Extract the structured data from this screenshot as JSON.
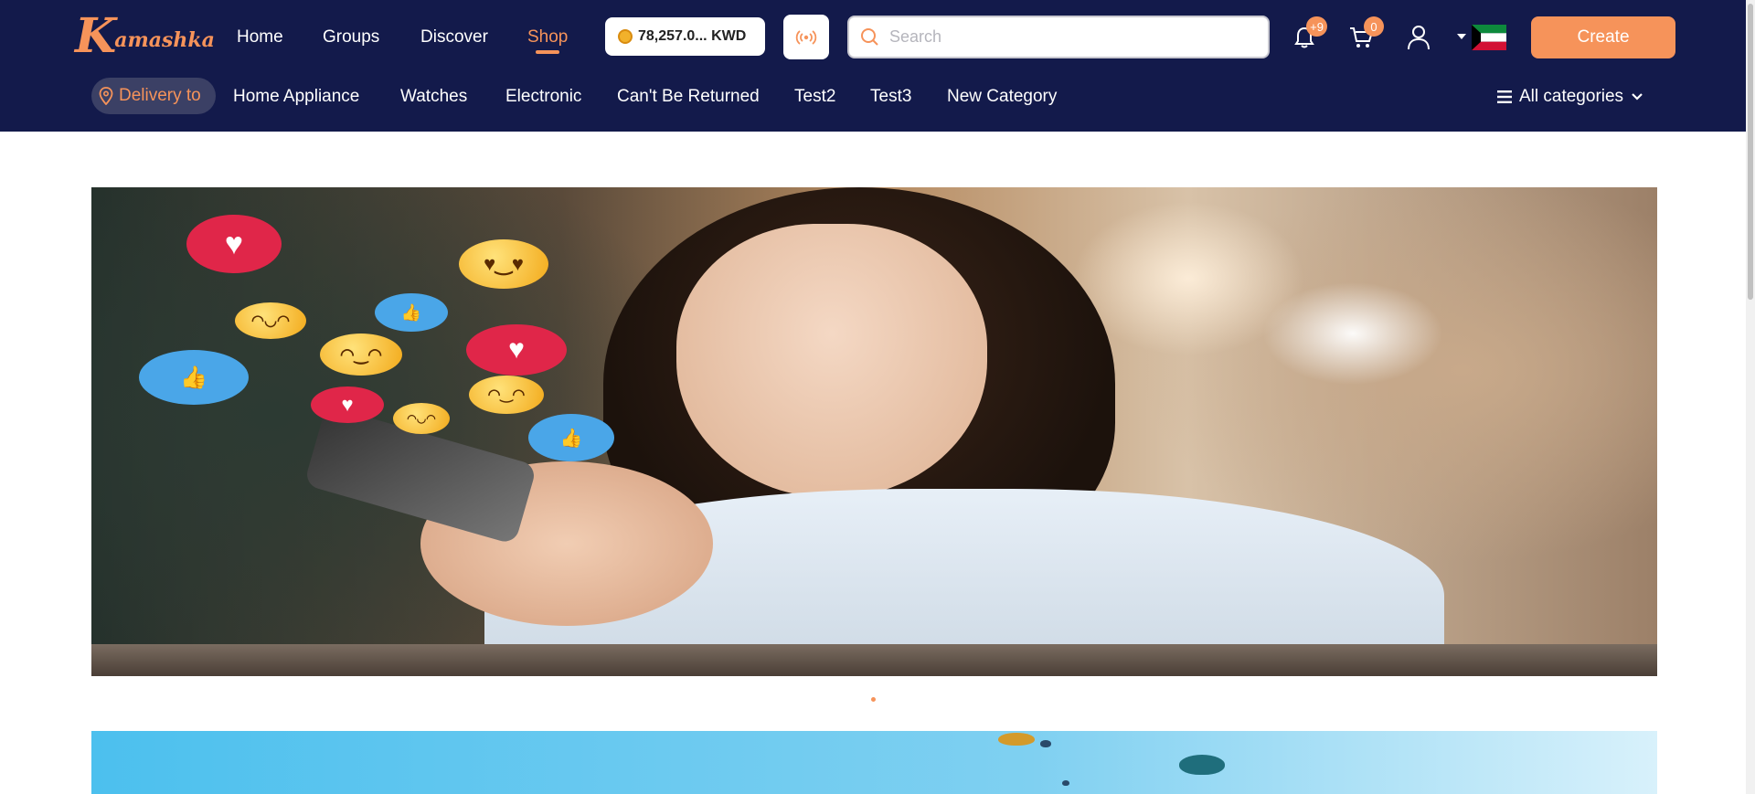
{
  "brand": {
    "logo_initial": "K",
    "logo_rest": "amashka"
  },
  "nav": {
    "items": [
      {
        "label": "Home",
        "active": false
      },
      {
        "label": "Groups",
        "active": false
      },
      {
        "label": "Discover",
        "active": false
      },
      {
        "label": "Shop",
        "active": true
      }
    ]
  },
  "wallet": {
    "balance": "78,257.0... KWD",
    "icon": "coin-icon"
  },
  "live": {
    "icon": "broadcast-icon"
  },
  "search": {
    "placeholder": "Search",
    "value": ""
  },
  "notifications": {
    "count": "+9",
    "icon": "bell-icon"
  },
  "cart": {
    "count": "0",
    "icon": "cart-icon"
  },
  "user": {
    "icon": "user-icon"
  },
  "country": {
    "icon": "kuwait-flag-icon"
  },
  "create_label": "Create",
  "subnav": {
    "delivery_label": "Delivery to",
    "categories": [
      "Home Appliance",
      "Watches",
      "Electronic",
      "Can't Be Returned",
      "Test2",
      "Test3",
      "New Category"
    ],
    "all_categories_label": "All categories"
  },
  "colors": {
    "topbar": "#131a4b",
    "accent": "#f6935a",
    "delivery_pill": "#3b4065"
  },
  "carousel": {
    "slide_count": 1,
    "active_slide": 1
  }
}
